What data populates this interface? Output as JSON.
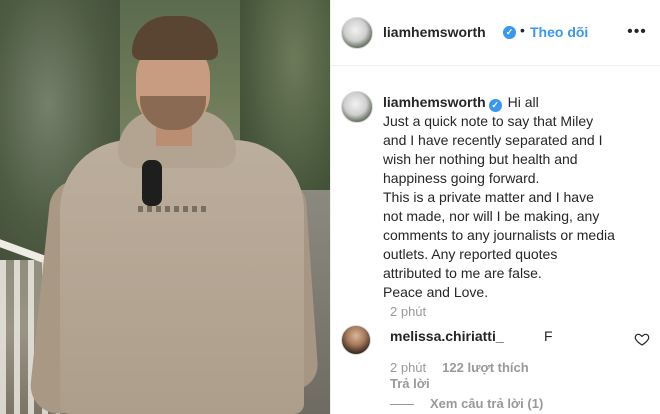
{
  "post": {
    "photo_alt": "",
    "header": {
      "username": "liamhemsworth",
      "dot": "•",
      "follow_label": "Theo dõi",
      "more_label": "•••"
    },
    "caption": {
      "username": "liamhemsworth",
      "lines": [
        "Hi all",
        "Just a quick note to say that Miley",
        "and I have recently separated and I",
        "wish her nothing but health and",
        "happiness going forward.",
        "This is a private matter and I have",
        "not made, nor will I be making, any",
        "comments to any journalists or media",
        "outlets. Any reported quotes",
        "attributed to me are false.",
        "Peace and Love."
      ],
      "time": "2 phút"
    },
    "comment": {
      "username": "melissa.chiriatti_",
      "text": "F",
      "time": "2 phút",
      "likes": "122 lượt thích",
      "reply_label": "Trả lời",
      "view_replies": "Xem câu trả lời (1)"
    }
  },
  "colors": {
    "accent": "#3897f0",
    "muted": "#999999",
    "text": "#262626"
  },
  "icons": {
    "verified": "verified-badge-icon",
    "heart": "heart-outline-icon",
    "more": "more-dots-icon"
  }
}
